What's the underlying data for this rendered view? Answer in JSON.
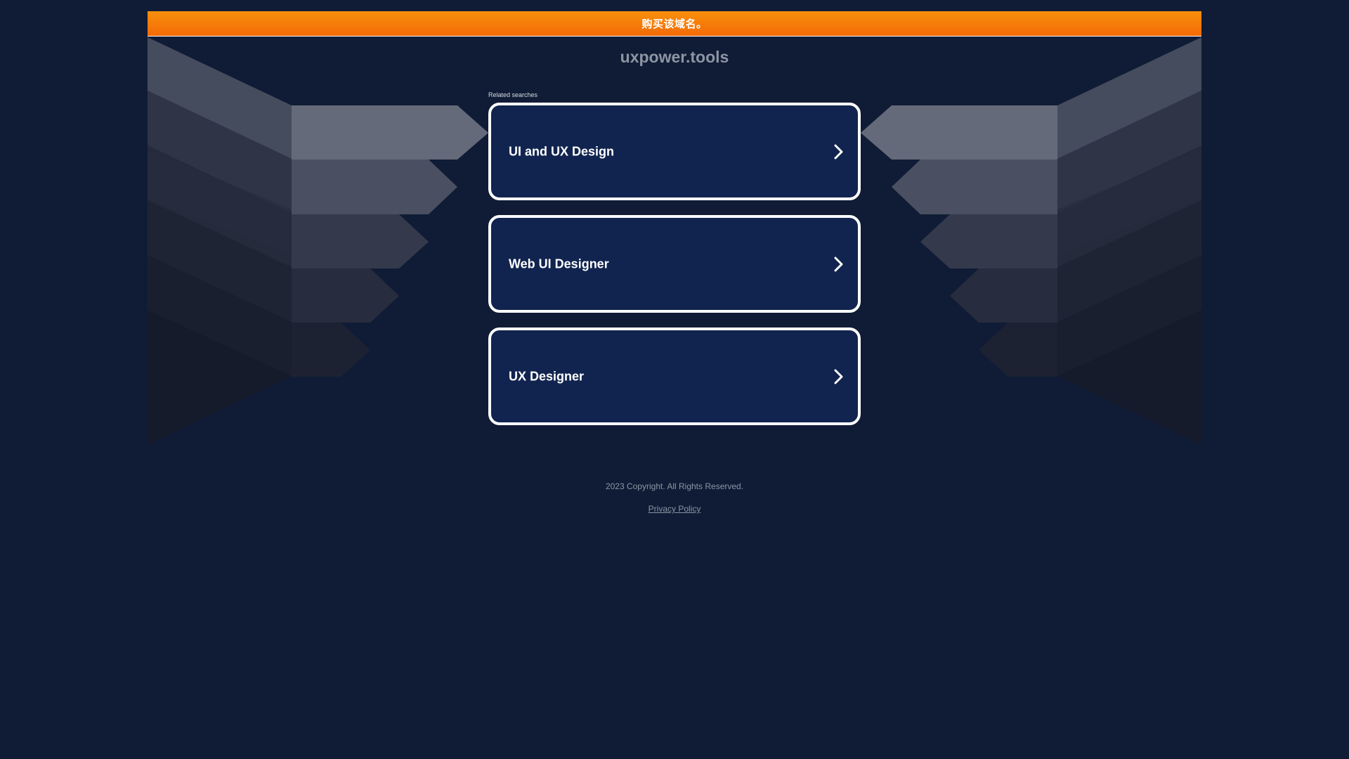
{
  "banner": {
    "text": "购买该域名。"
  },
  "domain": {
    "name": "uxpower.tools"
  },
  "related": {
    "label": "Related searches",
    "items": [
      {
        "label": "UI and UX Design"
      },
      {
        "label": "Web UI Designer"
      },
      {
        "label": "UX Designer"
      }
    ]
  },
  "footer": {
    "copyright": "2023 Copyright. All Rights Reserved.",
    "privacy_label": "Privacy Policy"
  },
  "colors": {
    "background": "#101c36",
    "banner_top": "#f7900c",
    "banner_bottom": "#f46a06",
    "card_fill": "#11244f",
    "card_border": "#ffffff"
  },
  "icons": {
    "card_arrow": "chevron-right-icon"
  }
}
